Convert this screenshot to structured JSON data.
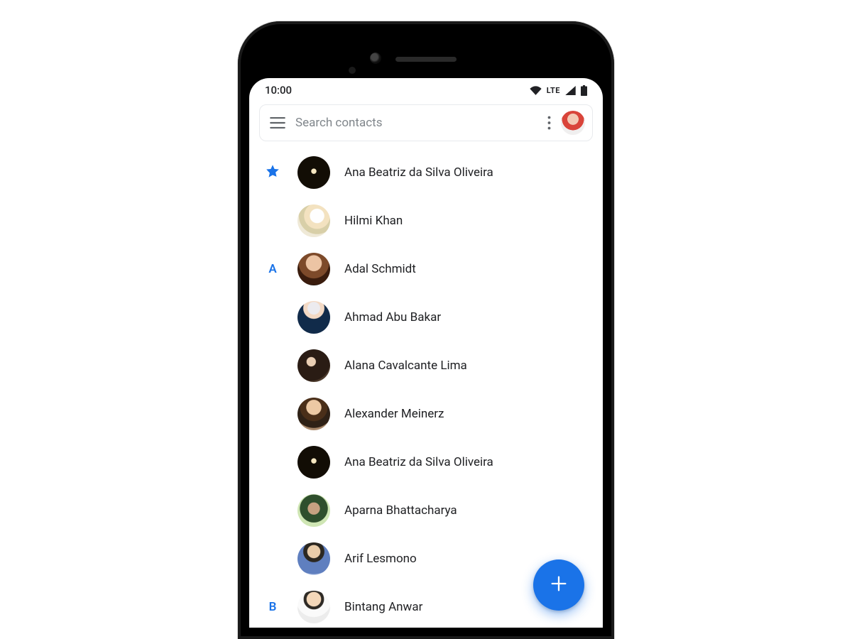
{
  "statusbar": {
    "time": "10:00",
    "network_label": "LTE"
  },
  "search": {
    "placeholder": "Search contacts"
  },
  "sections": [
    {
      "header_type": "star",
      "contacts": [
        {
          "name": "Ana Beatriz da Silva Oliveira",
          "avatar_class": "av0"
        },
        {
          "name": "Hilmi Khan",
          "avatar_class": "av1"
        }
      ]
    },
    {
      "header_type": "letter",
      "letter": "A",
      "contacts": [
        {
          "name": "Adal Schmidt",
          "avatar_class": "av2"
        },
        {
          "name": "Ahmad Abu Bakar",
          "avatar_class": "av3"
        },
        {
          "name": "Alana Cavalcante Lima",
          "avatar_class": "av4"
        },
        {
          "name": "Alexander Meinerz",
          "avatar_class": "av5"
        },
        {
          "name": "Ana Beatriz da Silva Oliveira",
          "avatar_class": "av6"
        },
        {
          "name": "Aparna Bhattacharya",
          "avatar_class": "av7"
        },
        {
          "name": "Arif Lesmono",
          "avatar_class": "av8"
        }
      ]
    },
    {
      "header_type": "letter",
      "letter": "B",
      "contacts": [
        {
          "name": "Bintang Anwar",
          "avatar_class": "av9"
        }
      ]
    }
  ],
  "colors": {
    "accent": "#1a73e8"
  }
}
